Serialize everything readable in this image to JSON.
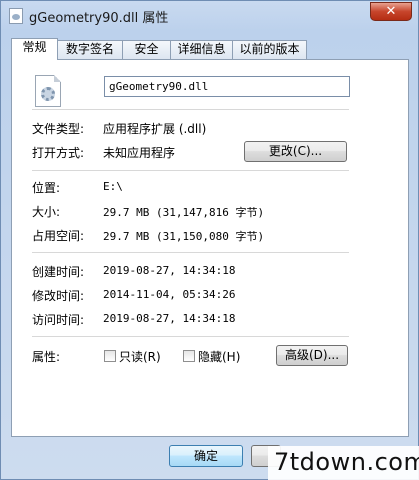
{
  "window": {
    "title": "gGeometry90.dll 属性",
    "close_label": "✕"
  },
  "tabs": [
    {
      "label": "常规"
    },
    {
      "label": "数字签名"
    },
    {
      "label": "安全"
    },
    {
      "label": "详细信息"
    },
    {
      "label": "以前的版本"
    }
  ],
  "general": {
    "file_name": "gGeometry90.dll",
    "file_icon": "dll-file-icon",
    "file_type_label": "文件类型:",
    "file_type_value": "应用程序扩展 (.dll)",
    "opens_with_label": "打开方式:",
    "opens_with_value": "未知应用程序",
    "change_button": "更改(C)...",
    "location_label": "位置:",
    "location_value": "E:\\",
    "size_label": "大小:",
    "size_value": "29.7 MB (31,147,816 字节)",
    "size_on_disk_label": "占用空间:",
    "size_on_disk_value": "29.7 MB (31,150,080 字节)",
    "created_label": "创建时间:",
    "created_value": "2019-08-27, 14:34:18",
    "modified_label": "修改时间:",
    "modified_value": "2014-11-04, 05:34:26",
    "accessed_label": "访问时间:",
    "accessed_value": "2019-08-27, 14:34:18",
    "attributes_label": "属性:",
    "readonly_label": "只读(R)",
    "hidden_label": "隐藏(H)",
    "advanced_button": "高级(D)..."
  },
  "footer": {
    "ok_button": "确定"
  },
  "watermark": "7tdown.com"
}
